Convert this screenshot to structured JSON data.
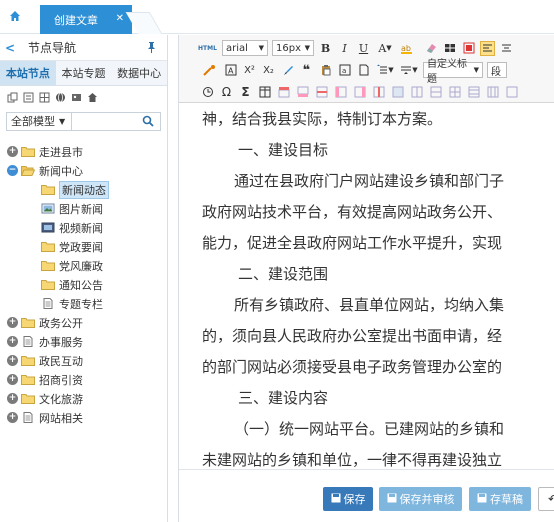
{
  "top_tabs": [
    {
      "label": "创建文章",
      "active": true
    }
  ],
  "left_panel": {
    "title": "节点导航",
    "subtabs": [
      "本站节点",
      "本站专题",
      "数据中心"
    ],
    "model_select": "全部模型",
    "tree": [
      {
        "label": "走进县市",
        "level": 0,
        "toggle": "plus",
        "icon": "folder"
      },
      {
        "label": "新闻中心",
        "level": 0,
        "toggle": "minus",
        "icon": "folder-open"
      },
      {
        "label": "新闻动态",
        "level": 1,
        "icon": "folder",
        "selected": true
      },
      {
        "label": "图片新闻",
        "level": 1,
        "icon": "image"
      },
      {
        "label": "视频新闻",
        "level": 1,
        "icon": "video"
      },
      {
        "label": "党政要闻",
        "level": 1,
        "icon": "folder"
      },
      {
        "label": "党风廉政",
        "level": 1,
        "icon": "folder"
      },
      {
        "label": "通知公告",
        "level": 1,
        "icon": "folder"
      },
      {
        "label": "专题专栏",
        "level": 1,
        "icon": "doc"
      },
      {
        "label": "政务公开",
        "level": 0,
        "toggle": "plus",
        "icon": "folder"
      },
      {
        "label": "办事服务",
        "level": 0,
        "toggle": "plus",
        "icon": "doc"
      },
      {
        "label": "政民互动",
        "level": 0,
        "toggle": "plus",
        "icon": "folder"
      },
      {
        "label": "招商引资",
        "level": 0,
        "toggle": "plus",
        "icon": "folder"
      },
      {
        "label": "文化旅游",
        "level": 0,
        "toggle": "plus",
        "icon": "folder"
      },
      {
        "label": "网站相关",
        "level": 0,
        "toggle": "plus",
        "icon": "doc"
      }
    ]
  },
  "editor": {
    "toolbar": {
      "html_label": "HTML",
      "font_family": "arial",
      "font_size": "16px",
      "bold": "B",
      "italic": "I",
      "underline": "U",
      "font_color": "A",
      "custom_heading": "自定义标题",
      "paragraph": "段"
    },
    "content": [
      {
        "text": "神，结合我县实际，特制订本方案。",
        "style": "plain"
      },
      {
        "text": "一、建设目标",
        "style": "h"
      },
      {
        "text": "通过在县政府门户网站建设乡镇和部门子",
        "style": "ind"
      },
      {
        "text": "政府网站技术平台，有效提高网站政务公开、",
        "style": "plain"
      },
      {
        "text": "能力，促进全县政府网站工作水平提升，实现",
        "style": "plain"
      },
      {
        "text": "二、建设范围",
        "style": "h"
      },
      {
        "text": "所有乡镇政府、县直单位网站，均纳入集",
        "style": "ind"
      },
      {
        "text": "的，须向县人民政府办公室提出书面申请，经",
        "style": "plain"
      },
      {
        "text": "的部门网站必须接受县电子政务管理办公室的",
        "style": "plain"
      },
      {
        "text": "三、建设内容",
        "style": "h"
      },
      {
        "text": "（一）统一网站平台。已建网站的乡镇和",
        "style": "ind"
      },
      {
        "text": "未建网站的乡镇和单位，一律不得再建设独立",
        "style": "plain"
      }
    ],
    "actions": {
      "save": "保存",
      "save_audit": "保存并审核",
      "save_draft": "存草稿"
    }
  }
}
